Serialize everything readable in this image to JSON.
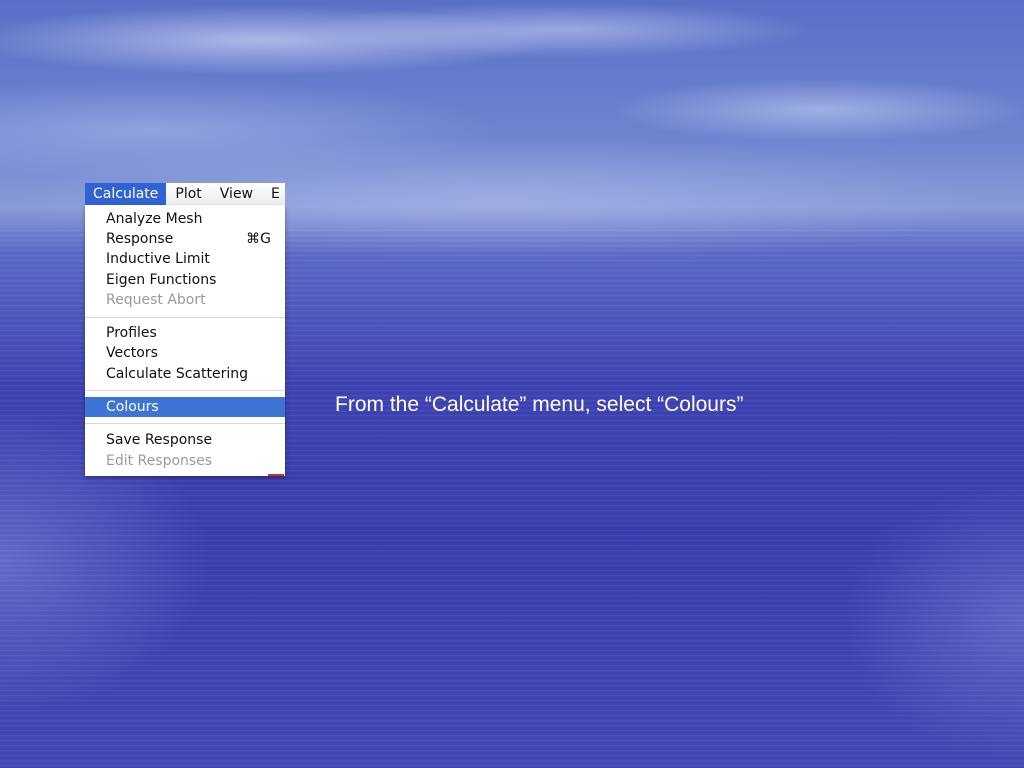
{
  "menubar": {
    "items": [
      {
        "label": "Calculate",
        "active": true
      },
      {
        "label": "Plot",
        "active": false
      },
      {
        "label": "View",
        "active": false
      },
      {
        "label": "E",
        "active": false
      }
    ]
  },
  "menu": {
    "items": [
      {
        "label": "Analyze Mesh",
        "shortcut": "",
        "disabled": false
      },
      {
        "label": "Response",
        "shortcut": "⌘G",
        "disabled": false
      },
      {
        "label": "Inductive Limit",
        "shortcut": "",
        "disabled": false
      },
      {
        "label": "Eigen Functions",
        "shortcut": "",
        "disabled": false
      },
      {
        "label": "Request Abort",
        "shortcut": "",
        "disabled": true
      },
      {
        "label": "Profiles",
        "shortcut": "",
        "disabled": false
      },
      {
        "label": "Vectors",
        "shortcut": "",
        "disabled": false
      },
      {
        "label": "Calculate Scattering",
        "shortcut": "",
        "disabled": false
      },
      {
        "label": "Colours",
        "shortcut": "",
        "disabled": false,
        "selected": true
      },
      {
        "label": "Save Response",
        "shortcut": "",
        "disabled": false
      },
      {
        "label": "Edit Responses",
        "shortcut": "",
        "disabled": true
      }
    ]
  },
  "slide": {
    "instruction": "From the “Calculate” menu, select “Colours”"
  },
  "colors": {
    "menu_highlight": "#3d74d6",
    "menubar_active": "#2f63d4",
    "disabled_text": "#9a9a9a",
    "background_blue": "#3a3db0"
  }
}
